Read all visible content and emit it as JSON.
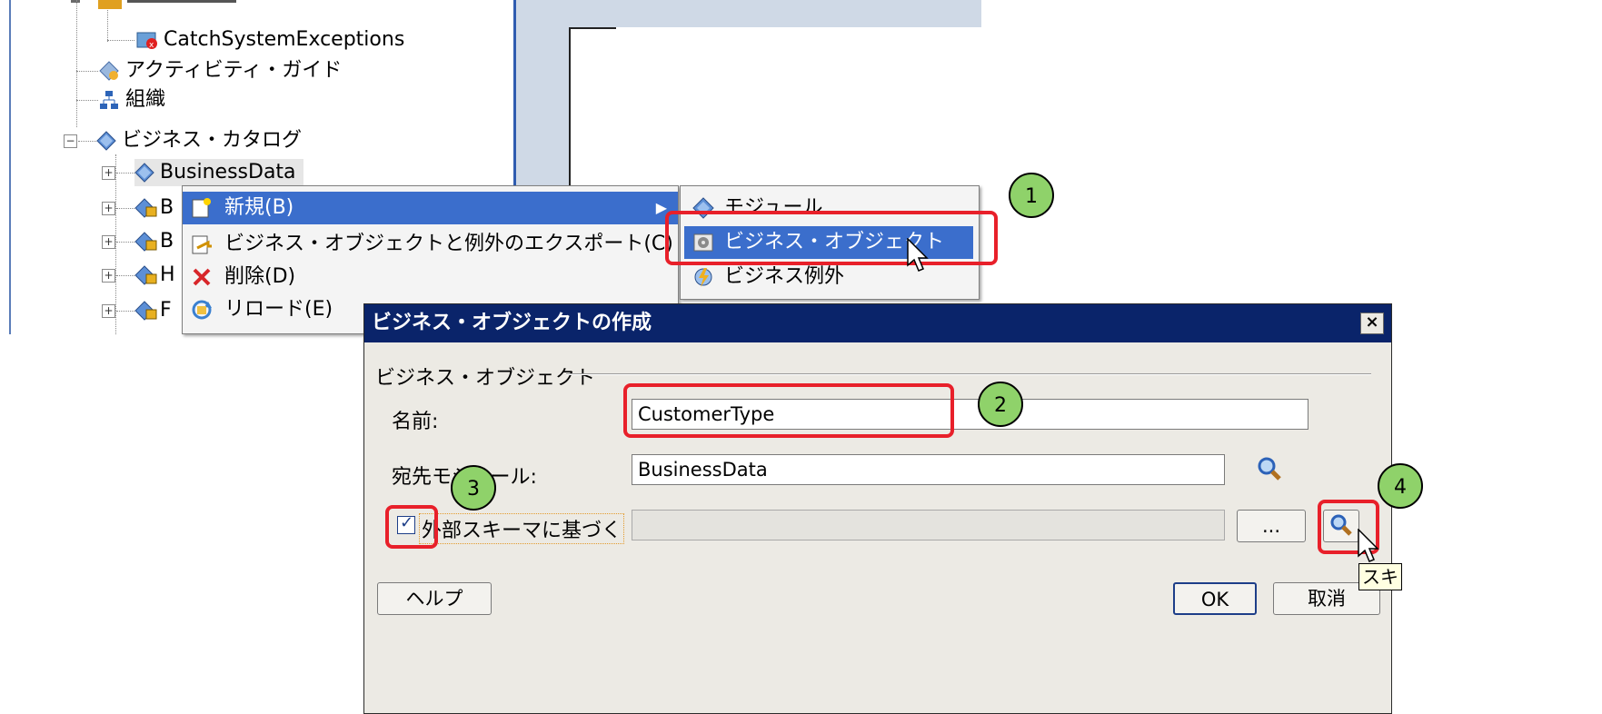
{
  "tree": {
    "items": [
      {
        "label": "CatchSystemExceptions"
      },
      {
        "label": "アクティビティ・ガイド"
      },
      {
        "label": "組織"
      },
      {
        "label": "ビジネス・カタログ"
      },
      {
        "label": "BusinessData"
      },
      {
        "label": "B"
      },
      {
        "label": "B"
      },
      {
        "label": "H"
      },
      {
        "label": "F"
      }
    ]
  },
  "context_menu": {
    "items": [
      {
        "label": "新規(B)"
      },
      {
        "label": "ビジネス・オブジェクトと例外のエクスポート(C)"
      },
      {
        "label": "削除(D)"
      },
      {
        "label": "リロード(E)"
      }
    ]
  },
  "submenu": {
    "items": [
      {
        "label": "モジュール"
      },
      {
        "label": "ビジネス・オブジェクト"
      },
      {
        "label": "ビジネス例外"
      }
    ]
  },
  "dialog": {
    "title": "ビジネス・オブジェクトの作成",
    "group_label": "ビジネス・オブジェクト",
    "name_label": "名前:",
    "name_value": "CustomerType",
    "dest_label": "宛先モジュール:",
    "dest_value": "BusinessData",
    "schema_label": "外部スキーマに基づく",
    "browse_label": "...",
    "help_label": "ヘルプ",
    "ok_label": "OK",
    "cancel_label": "取消",
    "close_label": "×",
    "tooltip": "スキ"
  },
  "callouts": [
    "1",
    "2",
    "3",
    "4"
  ],
  "colors": {
    "selection": "#3b6ecc",
    "title_bar": "#0a246a",
    "callout_fill": "#8fd26a",
    "highlight": "#e8202a"
  }
}
